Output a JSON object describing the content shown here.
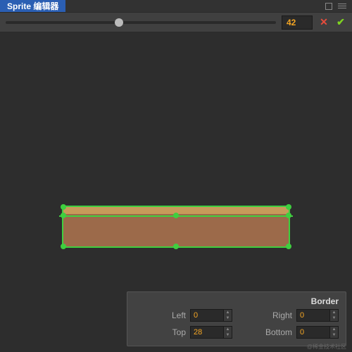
{
  "title": "Sprite 编辑器",
  "slider": {
    "value": "42",
    "position_pct": 42
  },
  "border": {
    "title": "Border",
    "left_label": "Left",
    "left_value": "0",
    "right_label": "Right",
    "right_value": "0",
    "top_label": "Top",
    "top_value": "28",
    "bottom_label": "Bottom",
    "bottom_value": "0"
  },
  "watermark": "@稀金技术社区"
}
